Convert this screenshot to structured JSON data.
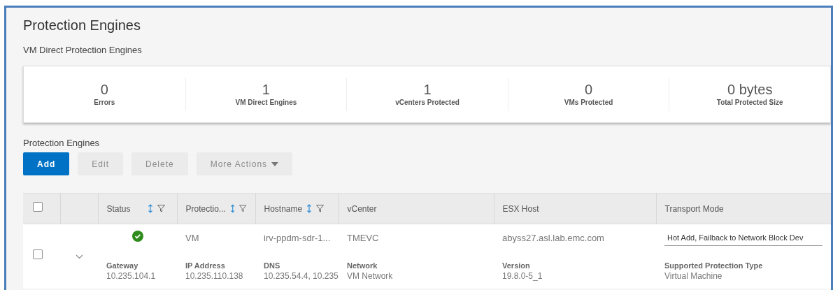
{
  "page": {
    "title": "Protection Engines",
    "subtitle": "VM Direct Protection Engines"
  },
  "stats": [
    {
      "value": "0",
      "label": "Errors"
    },
    {
      "value": "1",
      "label": "VM Direct Engines"
    },
    {
      "value": "1",
      "label": "vCenters Protected"
    },
    {
      "value": "0",
      "label": "VMs Protected"
    },
    {
      "value": "0 bytes",
      "label": "Total Protected Size"
    }
  ],
  "section_title": "Protection Engines",
  "toolbar": [
    {
      "label": "Add",
      "disabled": false,
      "primary": true,
      "dropdown": false
    },
    {
      "label": "Edit",
      "disabled": true,
      "primary": false,
      "dropdown": false
    },
    {
      "label": "Delete",
      "disabled": true,
      "primary": false,
      "dropdown": false
    },
    {
      "label": "More Actions",
      "disabled": true,
      "primary": false,
      "dropdown": true
    }
  ],
  "table": {
    "select_all_checked": false,
    "columns": [
      {
        "label": "Status",
        "sortable": true,
        "filterable": true
      },
      {
        "label": "Protectio...",
        "sortable": true,
        "filterable": true
      },
      {
        "label": "Hostname",
        "sortable": true,
        "filterable": true
      },
      {
        "label": "vCenter",
        "sortable": false,
        "filterable": false
      },
      {
        "label": "ESX Host",
        "sortable": false,
        "filterable": false
      },
      {
        "label": "Transport Mode",
        "sortable": false,
        "filterable": false
      }
    ],
    "rows": [
      {
        "checked": false,
        "expanded": true,
        "healthy": true,
        "cells": [
          "",
          "VM",
          "irv-ppdm-sdr-1...",
          "TMEVC",
          "abyss27.asl.lab.emc.com",
          "Hot Add, Failback to Network Block Dev"
        ],
        "details": [
          {
            "label": "Gateway",
            "value": "10.235.104.1"
          },
          {
            "label": "IP Address",
            "value": "10.235.110.138"
          },
          {
            "label": "DNS",
            "value": "10.235.54.4, 10.235"
          },
          {
            "label": "Network",
            "value": "VM Network"
          },
          {
            "label": "Version",
            "value": "19.8.0-5_1"
          },
          {
            "label": "Supported Protection Type",
            "value": "Virtual Machine"
          }
        ]
      }
    ]
  }
}
